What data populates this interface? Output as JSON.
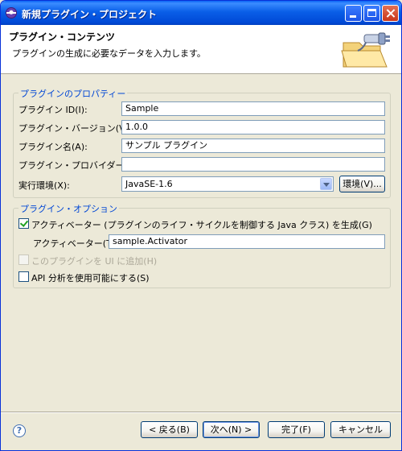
{
  "window": {
    "title": "新規プラグイン・プロジェクト"
  },
  "header": {
    "title": "プラグイン・コンテンツ",
    "description": "プラグインの生成に必要なデータを入力します。"
  },
  "properties": {
    "group_label": "プラグインのプロパティー",
    "id_label": "プラグイン ID(I):",
    "id_value": "Sample",
    "version_label": "プラグイン・バージョン(V):",
    "version_value": "1.0.0",
    "name_label": "プラグイン名(A):",
    "name_value": "サンプル プラグイン",
    "provider_label": "プラグイン・プロバイダー(D):",
    "provider_value": "",
    "env_label": "実行環境(X):",
    "env_value": "JavaSE-1.6",
    "env_button": "環境(V)..."
  },
  "options": {
    "group_label": "プラグイン・オプション",
    "activator_checkbox_label": "アクティベーター (プラグインのライフ・サイクルを制御する Java クラス) を生成(G)",
    "activator_checked": true,
    "activator_field_label": "アクティベーター(T):",
    "activator_value": "sample.Activator",
    "ui_checkbox_label": "このプラグインを UI に追加(H)",
    "ui_checked": false,
    "api_checkbox_label": "API 分析を使用可能にする(S)",
    "api_checked": false
  },
  "footer": {
    "help": "?",
    "back": "< 戻る(B)",
    "next": "次へ(N) >",
    "finish": "完了(F)",
    "cancel": "キャンセル"
  },
  "colors": {
    "titlebar": "#0a5fe8",
    "group_label": "#0046d5",
    "dialog_bg": "#ece9d8"
  }
}
